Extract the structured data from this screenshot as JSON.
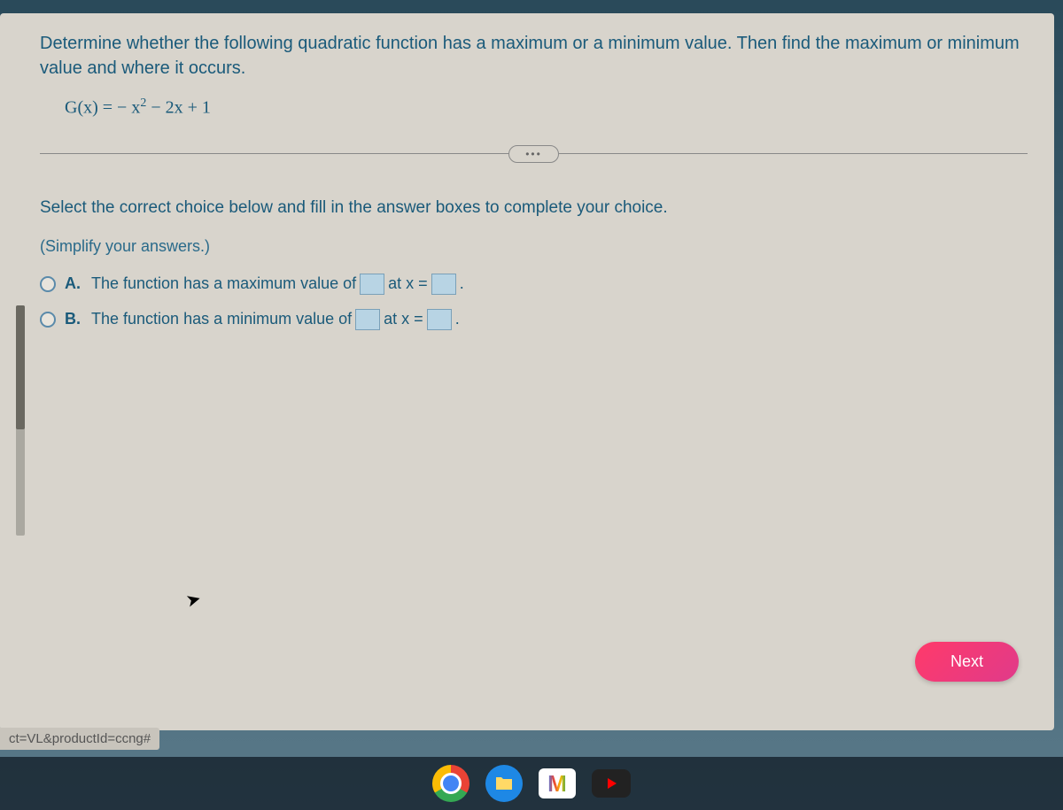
{
  "question": {
    "prompt": "Determine whether the following quadratic function has a maximum or a minimum value. Then find the maximum or minimum value and where it occurs.",
    "equation_prefix": "G(x) = − x",
    "equation_exp": "2",
    "equation_suffix": " − 2x + 1"
  },
  "ellipsis": "•••",
  "instruction": "Select the correct choice below and fill in the answer boxes to complete your choice.",
  "hint": "(Simplify your answers.)",
  "choices": [
    {
      "letter": "A.",
      "text_before": "The function has a maximum value of",
      "text_mid": "at x =",
      "text_after": "."
    },
    {
      "letter": "B.",
      "text_before": "The function has a minimum value of",
      "text_mid": "at x =",
      "text_after": "."
    }
  ],
  "next_label": "Next",
  "url_fragment": "ct=VL&productId=ccng#"
}
